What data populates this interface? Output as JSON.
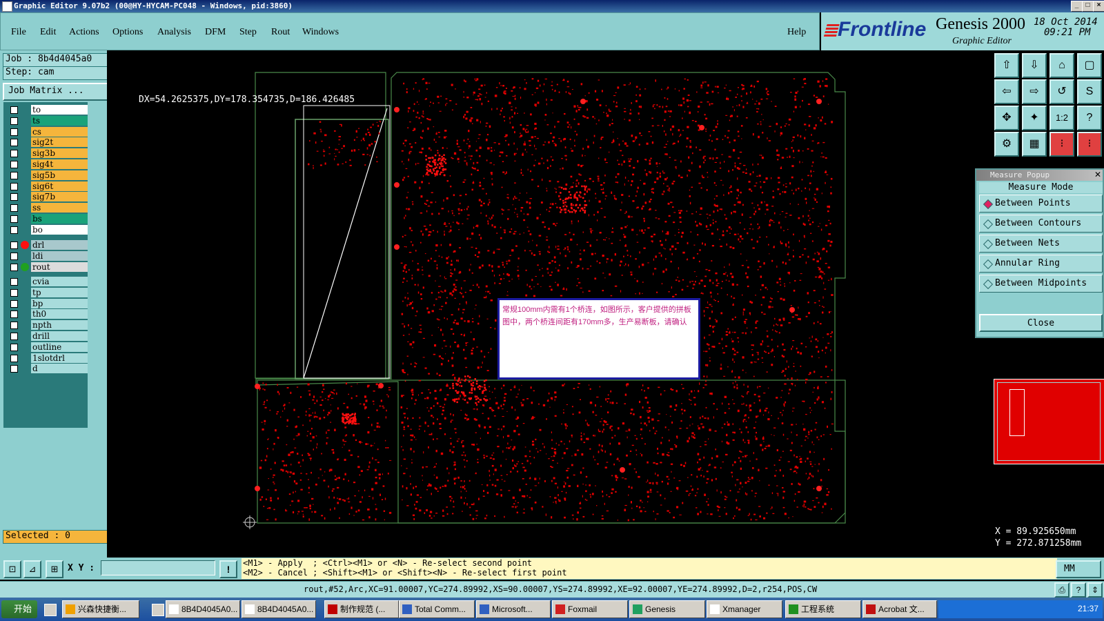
{
  "window": {
    "title": "Graphic Editor 9.07b2 (00@HY-HYCAM-PC048 - Windows, pid:3860)",
    "min_icon": "_",
    "max_icon": "□",
    "close_icon": "×"
  },
  "menu": {
    "file": "File",
    "edit": "Edit",
    "actions": "Actions",
    "options": "Options",
    "analysis": "Analysis",
    "dfm": "DFM",
    "step": "Step",
    "rout": "Rout",
    "windows": "Windows",
    "help": "Help"
  },
  "brand": {
    "logo": "Frontline",
    "product": "Genesis 2000",
    "subtitle": "Graphic Editor",
    "date": "18 Oct 2014",
    "time": "09:21 PM"
  },
  "left": {
    "job": "Job : 8b4d4045a0",
    "step": "Step: cam",
    "job_matrix": "Job Matrix ...",
    "selected": "Selected : 0",
    "layers": [
      {
        "name": "to",
        "bg": "#ffffff"
      },
      {
        "name": "ts",
        "bg": "#1aa27a"
      },
      {
        "name": "cs",
        "bg": "#f5b53c"
      },
      {
        "name": "sig2t",
        "bg": "#f5b53c"
      },
      {
        "name": "sig3b",
        "bg": "#f5b53c"
      },
      {
        "name": "sig4t",
        "bg": "#f5b53c"
      },
      {
        "name": "sig5b",
        "bg": "#f5b53c"
      },
      {
        "name": "sig6t",
        "bg": "#f5b53c"
      },
      {
        "name": "sig7b",
        "bg": "#f5b53c"
      },
      {
        "name": "ss",
        "bg": "#f5b53c"
      },
      {
        "name": "bs",
        "bg": "#1aa27a"
      },
      {
        "name": "bo",
        "bg": "#ffffff"
      }
    ],
    "drill_layers": [
      {
        "name": "drl",
        "bg": "#a8c8cc"
      },
      {
        "name": "ldi",
        "bg": "#a8c8cc"
      },
      {
        "name": "rout",
        "bg": "#dcdcdc"
      }
    ],
    "misc_layers": [
      {
        "name": "cvia",
        "bg": "#a8dcdc"
      },
      {
        "name": "tp",
        "bg": "#a8dcdc"
      },
      {
        "name": "bp",
        "bg": "#a8dcdc"
      },
      {
        "name": "th0",
        "bg": "#a8dcdc"
      },
      {
        "name": "npth",
        "bg": "#a8dcdc"
      },
      {
        "name": "drill",
        "bg": "#a8dcdc"
      },
      {
        "name": "outline",
        "bg": "#a8dcdc"
      },
      {
        "name": "1slotdrl",
        "bg": "#a8dcdc"
      },
      {
        "name": "d",
        "bg": "#a8dcdc"
      }
    ]
  },
  "canvas": {
    "measure_text": "DX=54.2625375,DY=178.354735,D=186.426485",
    "note": "常规100mm内需有1个桥连，如图所示，客户提供的拼板图中，两个桥连间距有170mm多，生产易断板，请确认"
  },
  "measure": {
    "title": "Measure Popup",
    "mode_label": "Measure Mode",
    "options": [
      "Between Points",
      "Between Contours",
      "Between Nets",
      "Annular Ring",
      "Between Midpoints"
    ],
    "selected": "Between Points",
    "close": "Close"
  },
  "coords": {
    "x": "X = 89.925650mm",
    "y": "Y = 272.871258mm"
  },
  "command": {
    "xy_label": "X Y :",
    "xy_value": "",
    "hint1": "<M1> - Apply  ; <Ctrl><M1> or <N> - Re-select second point",
    "hint2": "<M2> - Cancel ; <Shift><M1> or <Shift><N> - Re-select first point",
    "units": "MM",
    "warn": "!"
  },
  "status": {
    "text": "rout,#52,Arc,XC=91.00007,YC=274.89992,XS=90.00007,YS=274.89992,XE=92.00007,YE=274.89992,D=2,r254,POS,CW"
  },
  "taskbar": {
    "start": "开始",
    "items": [
      "兴森快捷衡...",
      "8B4D4045A0...",
      "8B4D4045A0...",
      "制作规范 (...",
      "Total Comm...",
      "Microsoft...",
      "Foxmail",
      "Genesis",
      "Xmanager",
      "工程系统",
      "Acrobat 文..."
    ],
    "clock": "21:37"
  },
  "colors": {
    "accent": "#8ecfcf",
    "pcb": "#e00000",
    "outline": "#4a8a4a"
  }
}
